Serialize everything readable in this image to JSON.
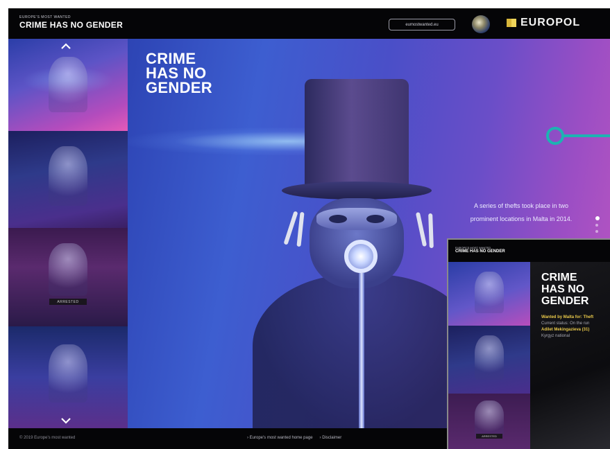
{
  "header": {
    "brand_small": "EUROPE'S MOST WANTED",
    "brand_title": "CRIME HAS NO GENDER",
    "site_url": "eumostwanted.eu",
    "logo_text": "EUROPOL",
    "seal_icon": "eu-seal-icon"
  },
  "sidebar": {
    "up_icon": "chevron-up-icon",
    "down_icon": "chevron-down-icon",
    "thumbnails": [
      {
        "name": "wanted-profile-1"
      },
      {
        "name": "wanted-profile-2"
      },
      {
        "name": "wanted-profile-3",
        "tag": "ARRESTED"
      },
      {
        "name": "wanted-profile-4"
      }
    ]
  },
  "hero": {
    "title_lines": [
      "CRIME",
      "HAS NO",
      "GENDER"
    ],
    "description": "A series of thefts took place in two prominent locations in Malta in 2014.",
    "connector_color": "#1db3b2"
  },
  "footer": {
    "copyright": "© 2019 Europe's most wanted",
    "links": [
      "› Europe's most wanted home page",
      "› Disclaimer"
    ]
  },
  "mobile": {
    "brand_small": "EUROPE'S MOST WANTED",
    "brand_title": "CRIME HAS NO GENDER",
    "title_lines": [
      "CRIME",
      "HAS NO",
      "GENDER"
    ],
    "wanted_line": "Wanted by Malta for: Theft",
    "status_line": "Current status: On the run",
    "name_line": "Adilet Mekingazieva (31)",
    "nationality_line": "Kyrgyz national",
    "thumb_tag": "ARRESTED"
  },
  "colors": {
    "accent_teal": "#1db3b2",
    "highlight_yellow": "#e8c84a",
    "header_bg": "#050507"
  }
}
